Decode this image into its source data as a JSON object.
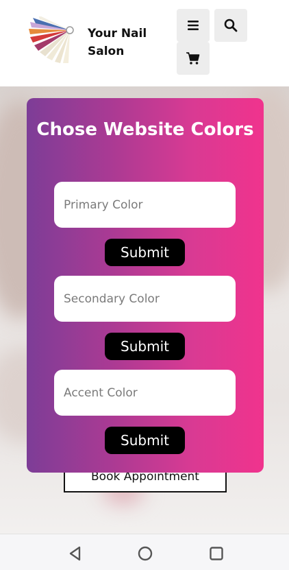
{
  "header": {
    "brand_name": "Your Nail Salon",
    "menu_icon": "hamburger-menu-icon",
    "search_icon": "search-icon",
    "cart_icon": "shopping-cart-icon"
  },
  "hero": {
    "book_label": "Book Appointment"
  },
  "color_form": {
    "title": "Chose Website Colors",
    "primary_placeholder": "Primary Color",
    "secondary_placeholder": "Secondary Color",
    "accent_placeholder": "Accent Color",
    "primary_submit": "Submit",
    "secondary_submit": "Submit",
    "accent_submit": "Submit",
    "gradient_start": "#7d3d97",
    "gradient_end": "#f0338d"
  },
  "system_nav": {
    "back_icon": "back-triangle-icon",
    "home_icon": "home-circle-icon",
    "recents_icon": "recents-square-icon"
  }
}
